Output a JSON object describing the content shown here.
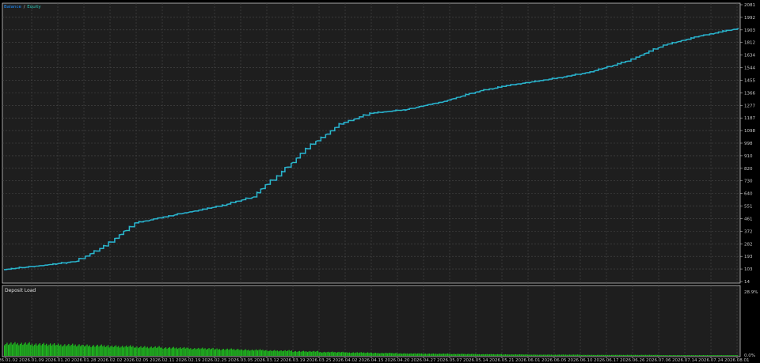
{
  "colors": {
    "background": "#1e1e1e",
    "frame": "#c8c8c8",
    "grid": "#4a4a4a",
    "balance": "#1e90ff",
    "equity": "#2ec4b6",
    "deposit_load": "#1fbf1f",
    "text": "#c8c8c8"
  },
  "legend": {
    "balance_label": "Balance",
    "separator": "/",
    "equity_label": "Equity"
  },
  "deposit_panel": {
    "title": "Deposit Load"
  },
  "chart_data": [
    {
      "type": "line",
      "title": "",
      "x": [
        0,
        0.05,
        0.1,
        0.14,
        0.18,
        0.24,
        0.3,
        0.34,
        0.38,
        0.42,
        0.46,
        0.5,
        0.55,
        0.6,
        0.65,
        0.7,
        0.75,
        0.8,
        0.85,
        0.9,
        0.95,
        1.0
      ],
      "x_tick_labels": [
        "2026.01.02",
        "2026.01.09",
        "2026.01.20",
        "2026.01.28",
        "2026.02.02",
        "2026.02.05",
        "2026.02.11",
        "2026.02.19",
        "2026.02.25",
        "2026.03.05",
        "2026.03.12",
        "2026.03.19",
        "2026.03.25",
        "2026.04.02",
        "2026.04.15",
        "2026.04.20",
        "2026.04.27",
        "2026.05.07",
        "2026.05.14",
        "2026.05.21",
        "2026.06.01",
        "2026.06.05",
        "2026.06.10",
        "2026.06.17",
        "2026.06.26",
        "2026.07.06",
        "2026.07.14",
        "2026.07.24",
        "2026.08.01"
      ],
      "y_tick_labels": [
        "2081",
        "1992",
        "1903",
        "1812",
        "1634",
        "1544",
        "1455",
        "1366",
        "1277",
        "1187",
        "1098",
        "998",
        "910",
        "820",
        "730",
        "640",
        "551",
        "461",
        "372",
        "282",
        "193",
        "103",
        "14"
      ],
      "ylim": [
        14,
        2081
      ],
      "series": [
        {
          "name": "Balance",
          "values": [
            103,
            133,
            166,
            280,
            452,
            520,
            583,
            646,
            834,
            1040,
            1190,
            1270,
            1300,
            1360,
            1440,
            1490,
            1530,
            1580,
            1660,
            1780,
            1850,
            1904
          ]
        },
        {
          "name": "Equity",
          "values": [
            103,
            133,
            166,
            280,
            452,
            520,
            583,
            646,
            834,
            1040,
            1190,
            1270,
            1300,
            1360,
            1440,
            1490,
            1530,
            1580,
            1660,
            1780,
            1850,
            1904
          ]
        }
      ]
    },
    {
      "type": "bar",
      "title": "Deposit Load",
      "y_tick_labels": [
        "28.9%",
        "0.0%"
      ],
      "ylim": [
        0,
        28.9
      ],
      "values": [
        5.2,
        4.9,
        4.6,
        4.3,
        4.0,
        3.7,
        3.4,
        3.1,
        2.8,
        2.5,
        2.2,
        1.9,
        1.6,
        1.4,
        1.2,
        1.0,
        0.9,
        0.8,
        0.7,
        0.6,
        0.5,
        0.5,
        0.4,
        0.4,
        0.4,
        0.3,
        0.3,
        0.3
      ]
    }
  ]
}
